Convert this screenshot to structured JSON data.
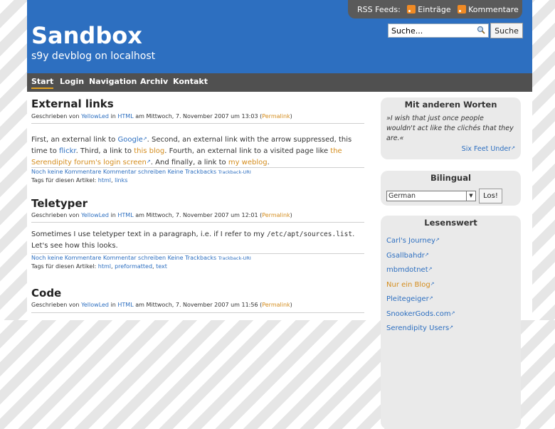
{
  "header": {
    "rss_label": "RSS Feeds:",
    "rss_entries": "Einträge",
    "rss_comments": "Kommentare",
    "title": "Sandbox",
    "description": "s9y devblog on localhost",
    "search_placeholder": "Suche...",
    "search_button": "Suche"
  },
  "nav": {
    "items": [
      "Start",
      "Login",
      "Navigation",
      "Archiv",
      "Kontakt"
    ]
  },
  "posts": [
    {
      "title": "External links",
      "byline": {
        "prefix": "Geschrieben von",
        "author": "YellowLed",
        "in": "in",
        "category": "HTML",
        "am": "am Mittwoch, 7. November 2007 um 13:03 (",
        "permalink": "Permalink",
        "close": ")"
      },
      "body": {
        "t1": "First, an external link to ",
        "l1": "Google",
        "t2": ". Second, an external link with the arrow suppressed, this time to ",
        "l2": "flickr",
        "t3": ". Third, a link to ",
        "l3": "this blog",
        "t4": ". Fourth, an external link to a visited page like ",
        "l4": "the Serendipity forum's login screen",
        "t5": ". And finally, a link to ",
        "l5": "my weblog",
        "t6": "."
      },
      "footer": {
        "comments": "Noch keine Kommentare",
        "write": "Kommentar schreiben",
        "trackbacks": "Keine Trackbacks",
        "trackback_uri": "Trackback-URI"
      },
      "tags_label": "Tags für diesen Artikel:",
      "tags": [
        "html",
        "links"
      ]
    },
    {
      "title": "Teletyper",
      "byline": {
        "prefix": "Geschrieben von",
        "author": "YellowLed",
        "in": "in",
        "category": "HTML",
        "am": "am Mittwoch, 7. November 2007 um 12:01 (",
        "permalink": "Permalink",
        "close": ")"
      },
      "body": {
        "t1": "Sometimes I use teletyper text in a paragraph, i.e. if I refer to my ",
        "code": "/etc/apt/sources.list",
        "t2": ". Let's see how this looks."
      },
      "footer": {
        "comments": "Noch keine Kommentare",
        "write": "Kommentar schreiben",
        "trackbacks": "Keine Trackbacks",
        "trackback_uri": "Trackback-URI"
      },
      "tags_label": "Tags für diesen Artikel:",
      "tags": [
        "html",
        "preformatted",
        "text"
      ]
    },
    {
      "title": "Code",
      "byline": {
        "prefix": "Geschrieben von",
        "author": "YellowLed",
        "in": "in",
        "category": "HTML",
        "am": "am Mittwoch, 7. November 2007 um 11:56 (",
        "permalink": "Permalink",
        "close": ")"
      }
    }
  ],
  "sidebar": {
    "quote_box": {
      "title": "Mit anderen Worten",
      "quote": "»I wish that just once people wouldn't act like the clichés that they are.«",
      "source": "Six Feet Under"
    },
    "bilingual": {
      "title": "Bilingual",
      "selected": "German",
      "button": "Los!"
    },
    "lesenswert": {
      "title": "Lesenswert",
      "links": [
        {
          "label": "Carl's Journey",
          "visited": false
        },
        {
          "label": "Gsallbahdr",
          "visited": false
        },
        {
          "label": "mbmdotnet",
          "visited": false
        },
        {
          "label": "Nur ein Blog",
          "visited": true
        },
        {
          "label": "Pleitegeiger",
          "visited": false
        },
        {
          "label": "SnookerGods.com",
          "visited": false
        },
        {
          "label": "Serendipity Users",
          "visited": false
        }
      ]
    }
  },
  "colors": {
    "header_blue": "#2d6fc0",
    "nav_gray": "#505050",
    "link_blue": "#2d6fc0",
    "visited_orange": "#d48c1c",
    "sidebar_box": "#eaeaea"
  },
  "icons": {
    "rss": "rss-feed-icon",
    "search": "magnifier-icon",
    "external": "external-link-arrow-icon",
    "select": "dropdown-arrow-icon"
  }
}
